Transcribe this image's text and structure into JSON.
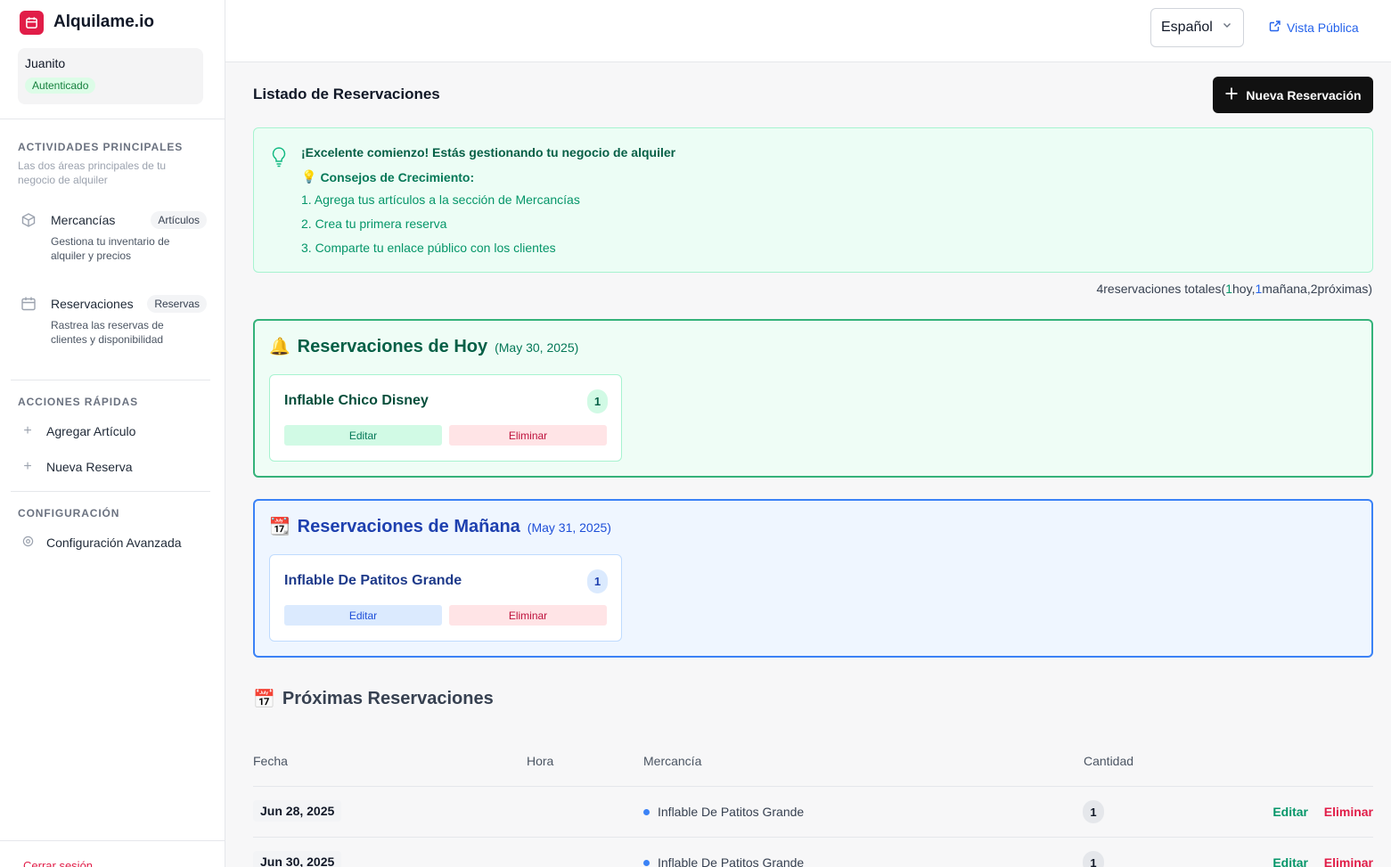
{
  "app": {
    "name": "Alquilame.io"
  },
  "user": {
    "name": "Juanito",
    "status": "Autenticado"
  },
  "sidebar": {
    "main_heading": "ACTIVIDADES PRINCIPALES",
    "main_sub": "Las dos áreas principales de tu negocio de alquiler",
    "items": [
      {
        "label": "Mercancías",
        "badge": "Artículos",
        "desc": "Gestiona tu inventario de alquiler y precios",
        "icon": "box-icon"
      },
      {
        "label": "Reservaciones",
        "badge": "Reservas",
        "desc": "Rastrea las reservas de clientes y disponibilidad",
        "icon": "calendar-icon"
      }
    ],
    "quick_heading": "ACCIONES RÁPIDAS",
    "quick": [
      {
        "label": "Agregar Artículo"
      },
      {
        "label": "Nueva Reserva"
      }
    ],
    "config_heading": "CONFIGURACIÓN",
    "config": {
      "label": "Configuración Avanzada"
    },
    "logout": "Cerrar sesión"
  },
  "topbar": {
    "language": "Español",
    "public_link": "Vista Pública"
  },
  "main": {
    "title": "Listado de Reservaciones",
    "new_button": "Nueva Reservación",
    "tips": {
      "title": "¡Excelente comienzo! Estás gestionando tu negocio de alquiler",
      "subtitle": "Consejos de Crecimiento:",
      "lines": [
        "1. Agrega tus artículos a la sección de Mercancías",
        "2. Crea tu primera reserva",
        "3. Comparte tu enlace público con los clientes"
      ]
    },
    "summary": {
      "total": "4",
      "total_label": "reservaciones totales",
      "today": "1",
      "today_label": "hoy",
      "tomorrow": "1",
      "tomorrow_label": "mañana",
      "upcoming": "2",
      "upcoming_label": "próximas"
    },
    "today": {
      "emoji": "🔔",
      "title": "Reservaciones de Hoy",
      "date": "(May 30, 2025)",
      "card": {
        "name": "Inflable Chico Disney",
        "qty": "1",
        "edit": "Editar",
        "delete": "Eliminar"
      }
    },
    "tomorrow": {
      "emoji": "📆",
      "title": "Reservaciones de Mañana",
      "date": "(May 31, 2025)",
      "card": {
        "name": "Inflable De Patitos Grande",
        "qty": "1",
        "edit": "Editar",
        "delete": "Eliminar"
      }
    },
    "upcoming": {
      "emoji": "📅",
      "title": "Próximas Reservaciones",
      "columns": [
        "Fecha",
        "Hora",
        "Mercancía",
        "Cantidad"
      ],
      "rows": [
        {
          "date": "Jun 28, 2025",
          "time": "",
          "item": "Inflable De Patitos Grande",
          "qty": "1",
          "edit": "Editar",
          "delete": "Eliminar"
        },
        {
          "date": "Jun 30, 2025",
          "time": "",
          "item": "Inflable De Patitos Grande",
          "qty": "1",
          "edit": "Editar",
          "delete": "Eliminar"
        }
      ]
    }
  },
  "colors": {
    "brand": "#e11d48",
    "today_accent": "#34b27a",
    "tomorrow_accent": "#3b82f6",
    "primary_button": "#111111",
    "link": "#2563eb"
  }
}
